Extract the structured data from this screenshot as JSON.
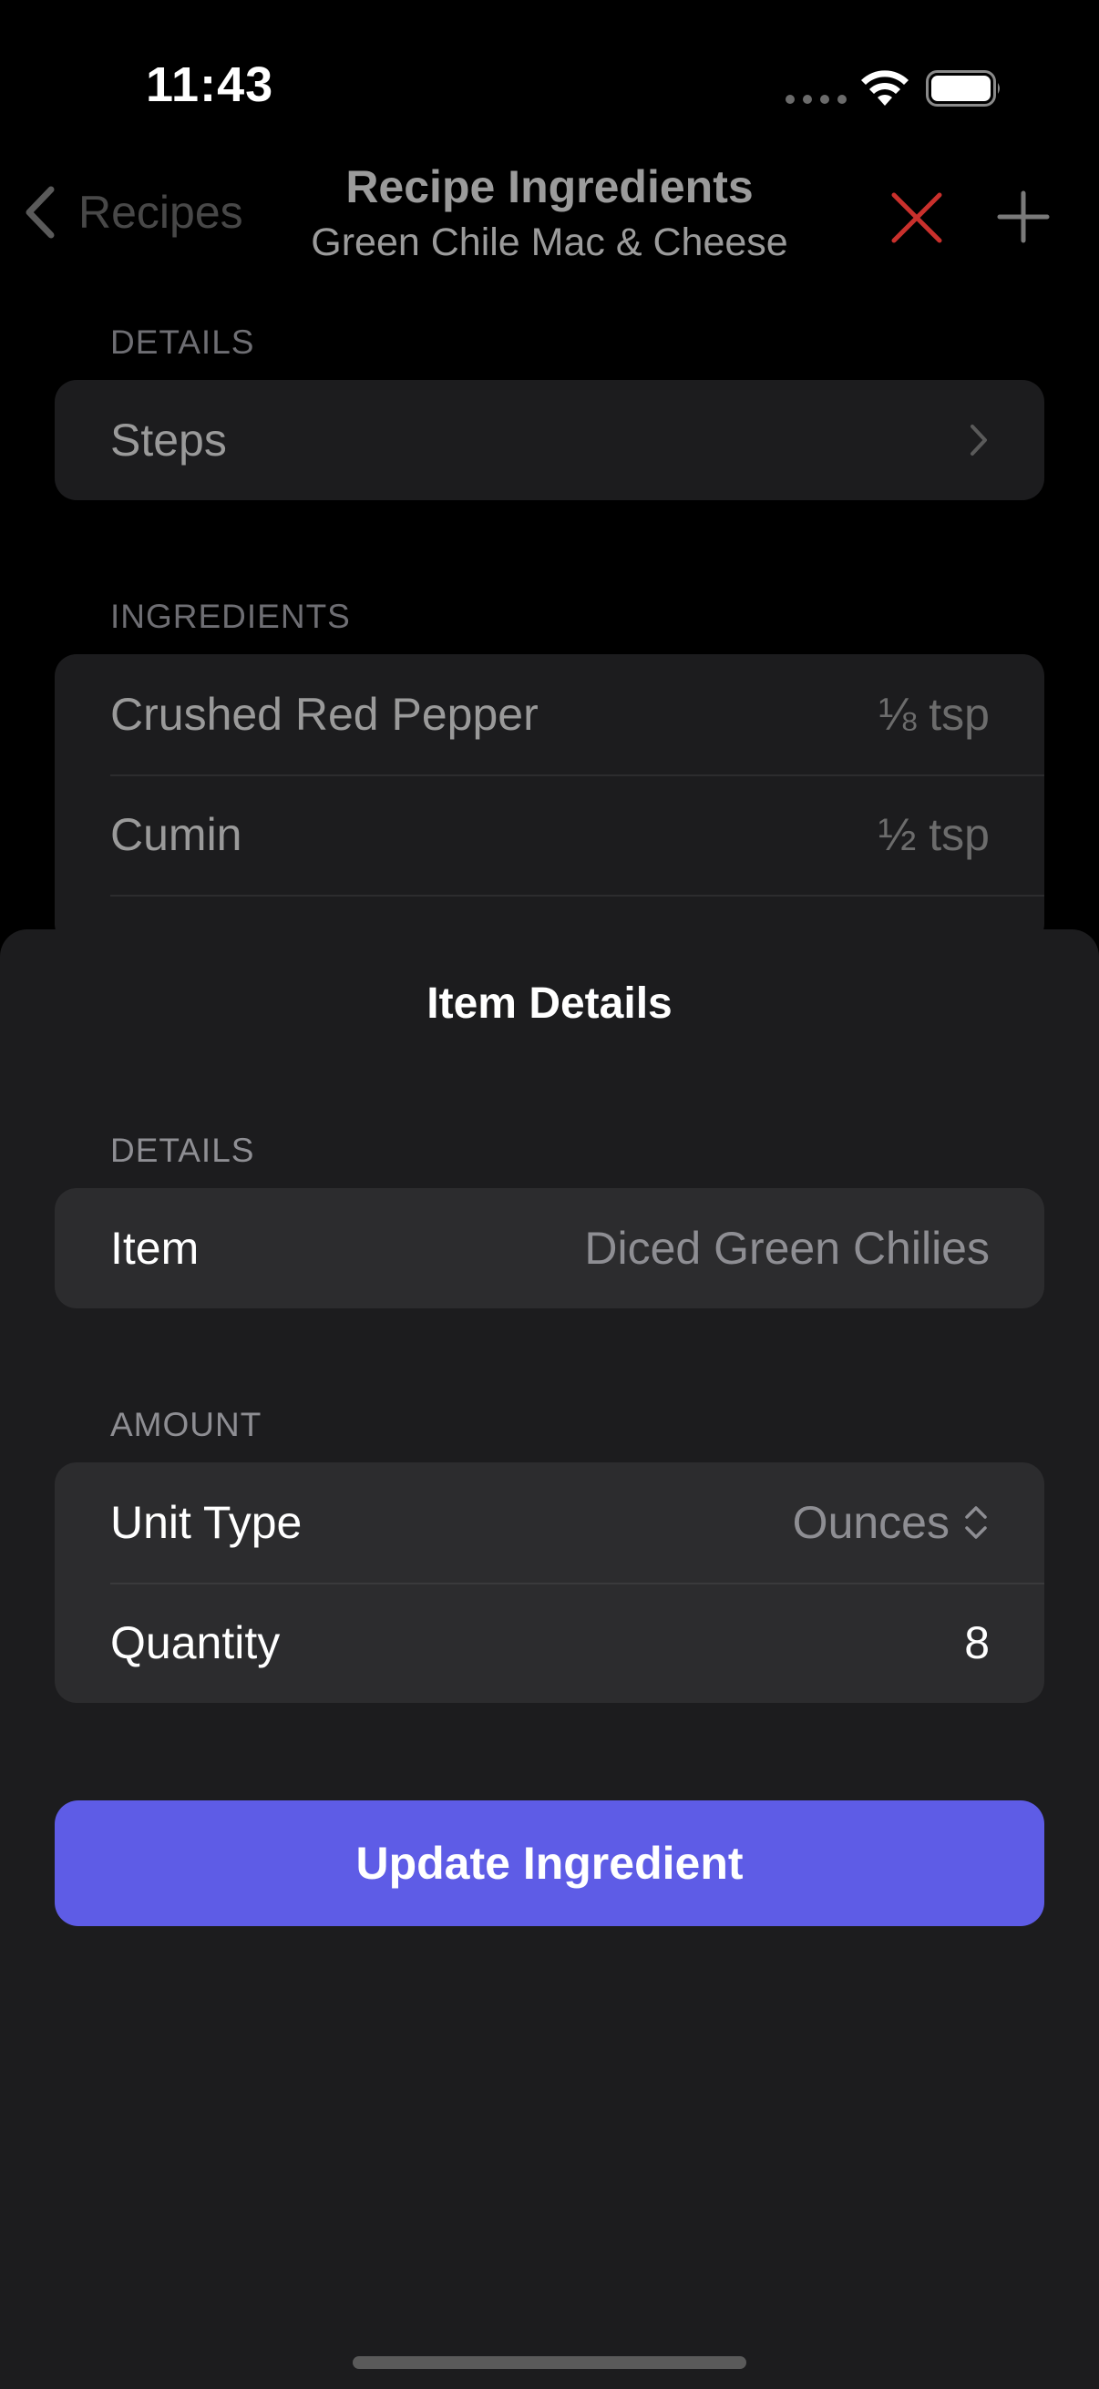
{
  "status_bar": {
    "time": "11:43"
  },
  "nav": {
    "back_label": "Recipes",
    "title": "Recipe Ingredients",
    "subtitle": "Green Chile Mac & Cheese",
    "close_color": "#d3342f"
  },
  "background": {
    "details_header": "DETAILS",
    "steps_label": "Steps",
    "ingredients_header": "INGREDIENTS",
    "ingredients": [
      {
        "name": "Crushed Red Pepper",
        "amount": "⅛ tsp"
      },
      {
        "name": "Cumin",
        "amount": "½ tsp"
      }
    ]
  },
  "sheet": {
    "title": "Item Details",
    "details_header": "DETAILS",
    "item_label": "Item",
    "item_value": "Diced Green Chilies",
    "amount_header": "AMOUNT",
    "unit_type_label": "Unit Type",
    "unit_type_value": "Ounces",
    "quantity_label": "Quantity",
    "quantity_value": "8",
    "update_button": "Update Ingredient",
    "accent_color": "#5e5ce6"
  }
}
